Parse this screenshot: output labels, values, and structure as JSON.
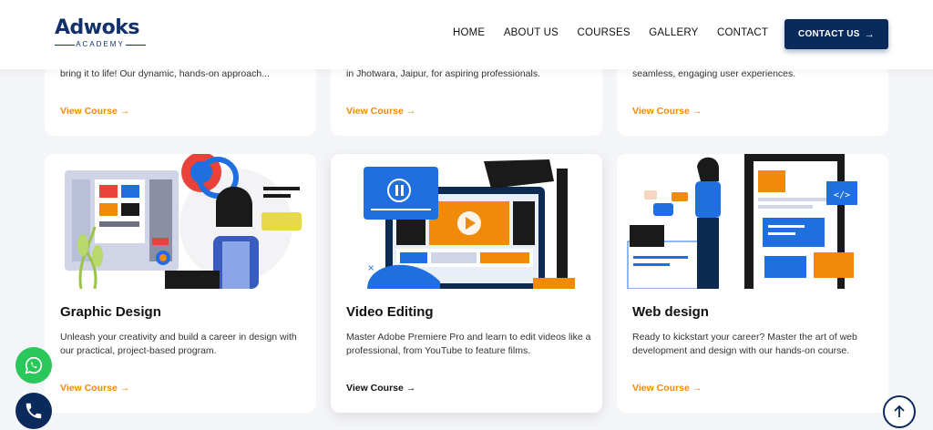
{
  "brand": {
    "logo_text": "Adwoks",
    "logo_sub": "ACADEMY"
  },
  "nav": {
    "items": [
      "HOME",
      "ABOUT US",
      "COURSES",
      "GALLERY",
      "CONTACT"
    ]
  },
  "cta": {
    "label": "CONTACT US",
    "arrow": "→"
  },
  "top_cards": [
    {
      "desc": "bring it to life! Our dynamic, hands-on approach...",
      "link": "View Course →"
    },
    {
      "desc": "in Jhotwara, Jaipur, for aspiring professionals.",
      "link": "View Course →"
    },
    {
      "desc": "seamless, engaging user experiences.",
      "link": "View Course →"
    }
  ],
  "courses": [
    {
      "title": "Graphic Design",
      "desc": "Unleash your creativity and build a career in design with our practical, project-based program.",
      "link": "View Course →",
      "icon": "graphic-design-illustration"
    },
    {
      "title": "Video Editing",
      "desc": "Master Adobe Premiere Pro and learn to edit videos like a professional, from YouTube to feature films.",
      "link": "View Course →",
      "icon": "video-editing-illustration"
    },
    {
      "title": "Web design",
      "desc": "Ready to kickstart your career? Master the art of web development and design with our hands-on course.",
      "link": "View Course →",
      "icon": "web-design-illustration"
    }
  ],
  "floating": {
    "whatsapp_icon": "whatsapp-icon",
    "phone_icon": "phone-icon",
    "scroll_top_icon": "arrow-up-icon"
  },
  "colors": {
    "navy": "#0b2a5c",
    "accent_orange": "#f08a0a",
    "whatsapp_green": "#2ac75a",
    "illustration_blue": "#1f6fe0"
  }
}
